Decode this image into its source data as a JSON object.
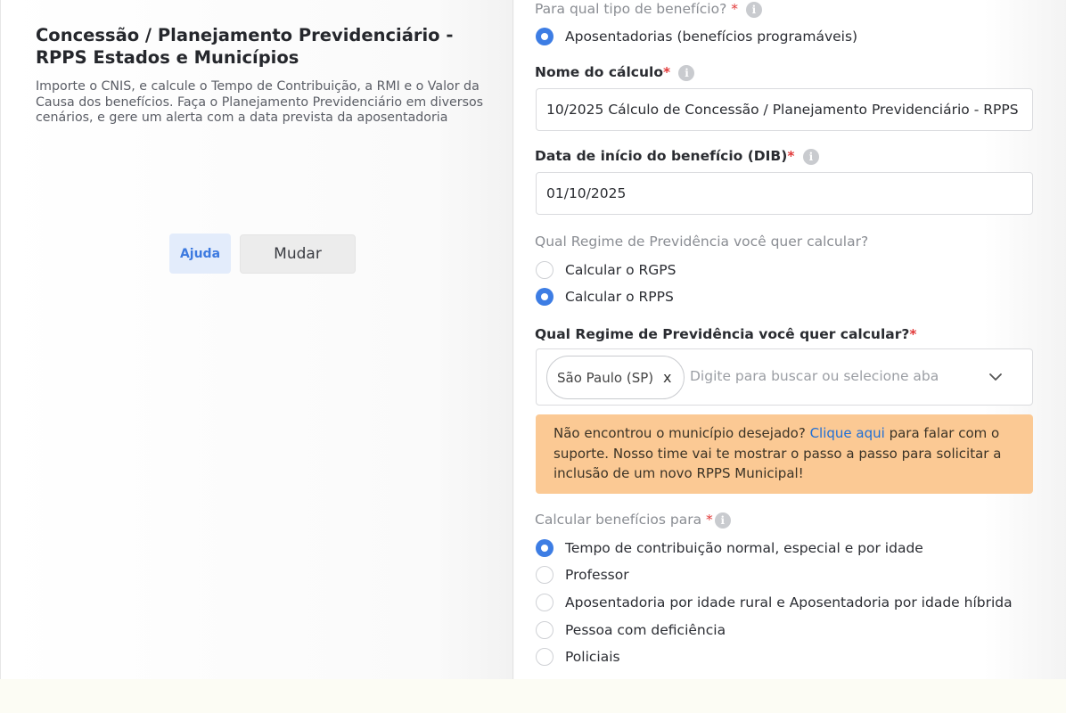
{
  "left": {
    "title": "Concessão / Planejamento Previdenciário - RPPS Estados e Municípios",
    "description": "Importe o CNIS, e calcule o Tempo de Contribuição, a RMI e o Valor da Causa dos benefícios. Faça o Planejamento Previdenciário em diversos cenários, e gere um alerta com a data prevista da aposentadoria",
    "help_label": "Ajuda",
    "change_label": "Mudar"
  },
  "form": {
    "benefit_type": {
      "label": "Para qual tipo de benefício?",
      "required": "*",
      "options": [
        {
          "label": "Aposentadorias (benefícios programáveis)",
          "selected": true
        }
      ]
    },
    "calc_name": {
      "label": "Nome do cálculo",
      "required": "*",
      "value": "10/2025 Cálculo de Concessão / Planejamento Previdenciário - RPPS"
    },
    "dib": {
      "label": "Data de início do benefício (DIB)",
      "required": "*",
      "value": "01/10/2025"
    },
    "regime": {
      "label": "Qual Regime de Previdência você quer calcular?",
      "options": [
        {
          "label": "Calcular o RGPS",
          "selected": false
        },
        {
          "label": "Calcular o RPPS",
          "selected": true
        }
      ]
    },
    "regime_select": {
      "label": "Qual Regime de Previdência você quer calcular?",
      "required": "*",
      "chip": "São Paulo (SP)",
      "chip_remove": "x",
      "placeholder": "Digite para buscar ou selecione aba"
    },
    "alert": {
      "lead": "Não encontrou o município desejado?",
      "link": "Clique aqui",
      "rest": "para falar com o suporte. Nosso time vai te mostrar o passo a passo para solicitar a inclusão de um novo RPPS Municipal!"
    },
    "benefits_for": {
      "label": "Calcular benefícios para",
      "required": "*",
      "options": [
        {
          "label": "Tempo de contribuição normal, especial e por idade",
          "selected": true
        },
        {
          "label": "Professor",
          "selected": false
        },
        {
          "label": "Aposentadoria por idade rural e Aposentadoria por idade híbrida",
          "selected": false
        },
        {
          "label": "Pessoa com deficiência",
          "selected": false
        },
        {
          "label": "Policiais",
          "selected": false
        }
      ]
    }
  },
  "colors": {
    "accent": "#3d7de4",
    "required": "#e23a3a",
    "alert_bg": "#fbc994",
    "link": "#1f6fd6"
  }
}
